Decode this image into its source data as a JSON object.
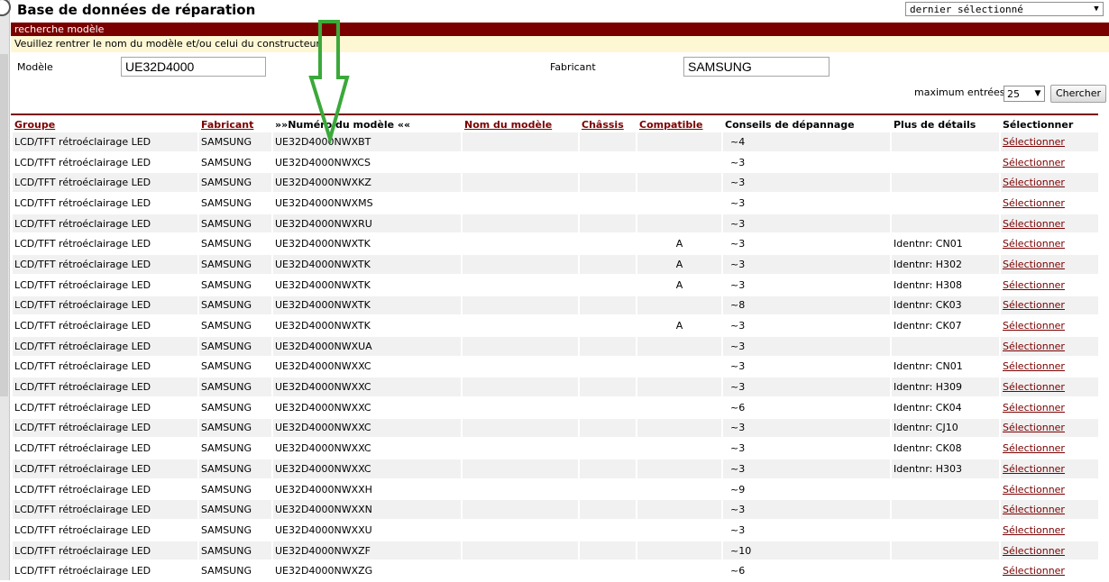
{
  "header": {
    "title": "Base de données de réparation",
    "last_selected": "dernier sélectionné"
  },
  "search": {
    "section_title": "recherche modèle",
    "instructions": "Veuillez rentrer le nom du modèle et/ou celui du constructeur.",
    "model_label": "Modèle",
    "model_value": "UE32D4000",
    "manufacturer_label": "Fabricant",
    "manufacturer_value": "SAMSUNG",
    "max_entries_label": "maximum entrées",
    "max_entries_value": "25",
    "search_button": "Chercher"
  },
  "table": {
    "headers": {
      "group": "Groupe",
      "manufacturer": "Fabricant",
      "model_number": "»»Numéro du modèle ««",
      "model_name": "Nom du modèle",
      "chassis": "Châssis",
      "compatible": "Compatible",
      "tips": "Conseils de dépannage",
      "details": "Plus de détails",
      "select": "Sélectionner"
    },
    "rows": [
      {
        "group": "LCD/TFT rétroéclairage LED",
        "manufacturer": "SAMSUNG",
        "model": "UE32D4000NWXBT",
        "compatible": "",
        "tips": "~4",
        "details": "",
        "select": "Sélectionner"
      },
      {
        "group": "LCD/TFT rétroéclairage LED",
        "manufacturer": "SAMSUNG",
        "model": "UE32D4000NWXCS",
        "compatible": "",
        "tips": "~3",
        "details": "",
        "select": "Sélectionner"
      },
      {
        "group": "LCD/TFT rétroéclairage LED",
        "manufacturer": "SAMSUNG",
        "model": "UE32D4000NWXKZ",
        "compatible": "",
        "tips": "~3",
        "details": "",
        "select": "Sélectionner"
      },
      {
        "group": "LCD/TFT rétroéclairage LED",
        "manufacturer": "SAMSUNG",
        "model": "UE32D4000NWXMS",
        "compatible": "",
        "tips": "~3",
        "details": "",
        "select": "Sélectionner"
      },
      {
        "group": "LCD/TFT rétroéclairage LED",
        "manufacturer": "SAMSUNG",
        "model": "UE32D4000NWXRU",
        "compatible": "",
        "tips": "~3",
        "details": "",
        "select": "Sélectionner"
      },
      {
        "group": "LCD/TFT rétroéclairage LED",
        "manufacturer": "SAMSUNG",
        "model": "UE32D4000NWXTK",
        "compatible": "A",
        "tips": "~3",
        "details": "Identnr: CN01",
        "select": "Sélectionner"
      },
      {
        "group": "LCD/TFT rétroéclairage LED",
        "manufacturer": "SAMSUNG",
        "model": "UE32D4000NWXTK",
        "compatible": "A",
        "tips": "~3",
        "details": "Identnr: H302",
        "select": "Sélectionner"
      },
      {
        "group": "LCD/TFT rétroéclairage LED",
        "manufacturer": "SAMSUNG",
        "model": "UE32D4000NWXTK",
        "compatible": "A",
        "tips": "~3",
        "details": "Identnr: H308",
        "select": "Sélectionner"
      },
      {
        "group": "LCD/TFT rétroéclairage LED",
        "manufacturer": "SAMSUNG",
        "model": "UE32D4000NWXTK",
        "compatible": "",
        "tips": "~8",
        "details": "Identnr: CK03",
        "select": "Sélectionner"
      },
      {
        "group": "LCD/TFT rétroéclairage LED",
        "manufacturer": "SAMSUNG",
        "model": "UE32D4000NWXTK",
        "compatible": "A",
        "tips": "~3",
        "details": "Identnr: CK07",
        "select": "Sélectionner"
      },
      {
        "group": "LCD/TFT rétroéclairage LED",
        "manufacturer": "SAMSUNG",
        "model": "UE32D4000NWXUA",
        "compatible": "",
        "tips": "~3",
        "details": "",
        "select": "Sélectionner"
      },
      {
        "group": "LCD/TFT rétroéclairage LED",
        "manufacturer": "SAMSUNG",
        "model": "UE32D4000NWXXC",
        "compatible": "",
        "tips": "~3",
        "details": "Identnr: CN01",
        "select": "Sélectionner"
      },
      {
        "group": "LCD/TFT rétroéclairage LED",
        "manufacturer": "SAMSUNG",
        "model": "UE32D4000NWXXC",
        "compatible": "",
        "tips": "~3",
        "details": "Identnr: H309",
        "select": "Sélectionner"
      },
      {
        "group": "LCD/TFT rétroéclairage LED",
        "manufacturer": "SAMSUNG",
        "model": "UE32D4000NWXXC",
        "compatible": "",
        "tips": "~6",
        "details": "Identnr: CK04",
        "select": "Sélectionner"
      },
      {
        "group": "LCD/TFT rétroéclairage LED",
        "manufacturer": "SAMSUNG",
        "model": "UE32D4000NWXXC",
        "compatible": "",
        "tips": "~3",
        "details": "Identnr: CJ10",
        "select": "Sélectionner"
      },
      {
        "group": "LCD/TFT rétroéclairage LED",
        "manufacturer": "SAMSUNG",
        "model": "UE32D4000NWXXC",
        "compatible": "",
        "tips": "~3",
        "details": "Identnr: CK08",
        "select": "Sélectionner"
      },
      {
        "group": "LCD/TFT rétroéclairage LED",
        "manufacturer": "SAMSUNG",
        "model": "UE32D4000NWXXC",
        "compatible": "",
        "tips": "~3",
        "details": "Identnr: H303",
        "select": "Sélectionner"
      },
      {
        "group": "LCD/TFT rétroéclairage LED",
        "manufacturer": "SAMSUNG",
        "model": "UE32D4000NWXXH",
        "compatible": "",
        "tips": "~9",
        "details": "",
        "select": "Sélectionner"
      },
      {
        "group": "LCD/TFT rétroéclairage LED",
        "manufacturer": "SAMSUNG",
        "model": "UE32D4000NWXXN",
        "compatible": "",
        "tips": "~3",
        "details": "",
        "select": "Sélectionner"
      },
      {
        "group": "LCD/TFT rétroéclairage LED",
        "manufacturer": "SAMSUNG",
        "model": "UE32D4000NWXXU",
        "compatible": "",
        "tips": "~3",
        "details": "",
        "select": "Sélectionner"
      },
      {
        "group": "LCD/TFT rétroéclairage LED",
        "manufacturer": "SAMSUNG",
        "model": "UE32D4000NWXZF",
        "compatible": "",
        "tips": "~10",
        "details": "",
        "select": "Sélectionner"
      },
      {
        "group": "LCD/TFT rétroéclairage LED",
        "manufacturer": "SAMSUNG",
        "model": "UE32D4000NWXZG",
        "compatible": "",
        "tips": "~6",
        "details": "",
        "select": "Sélectionner"
      }
    ]
  },
  "annotation": {
    "arrow_color": "#3aa93a",
    "icon": "down-arrow-annotation-icon"
  },
  "colors": {
    "accent": "#7a0000",
    "notice_bg": "#fdf7d4",
    "row_alt": "#f1f1f1"
  }
}
